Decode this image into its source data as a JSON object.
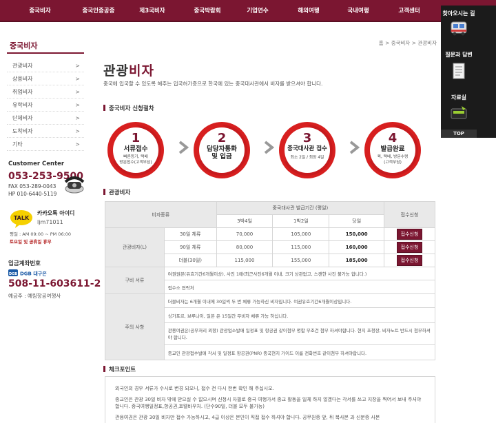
{
  "nav": {
    "items": [
      "중국비자",
      "중국인증공증",
      "제3국비자",
      "중국박람회",
      "기업연수",
      "해외여행",
      "국내여행",
      "고객센터"
    ]
  },
  "quick_panel": {
    "directions_label": "찾아오시는 길",
    "qna_label": "질문과 답변",
    "library_label": "자료실",
    "top_label": "TOP"
  },
  "sidebar": {
    "title": "중국비자",
    "items": [
      {
        "label": "관광비자",
        "arrow": ">"
      },
      {
        "label": "상용비자",
        "arrow": ">"
      },
      {
        "label": "취업비자",
        "arrow": ">"
      },
      {
        "label": "유학비자",
        "arrow": ">"
      },
      {
        "label": "단체비자",
        "arrow": ">"
      },
      {
        "label": "도착비자",
        "arrow": ">"
      },
      {
        "label": "기타",
        "arrow": ">"
      }
    ]
  },
  "customer_center": {
    "title": "Customer Center",
    "phone": "053-253-9500",
    "fax": "FAX  053-289-0043",
    "hp": "HP   010-6440-5119"
  },
  "kakao": {
    "badge": "TALK",
    "title": "카카오톡 아이디",
    "id": "ljm71011",
    "hours": "평일 : AM 09:00 ~ PM 06:00",
    "holiday": "토요일 및 공휴일 휴무"
  },
  "account": {
    "title": "입금계좌번호",
    "bank": "DGB 대구은행",
    "number": "508-11-603611-2",
    "holder": "예금주 : 예림항공여행사"
  },
  "breadcrumb": "홈 > 중국비자 > 관광비자",
  "page": {
    "title_main": "관광",
    "title_accent": "비자",
    "description": "중국에 입국할 수 있도록 해주는 입국허가증으로 한국에 있는 중국대사관에서 비자를 받으셔야 합니다."
  },
  "process": {
    "heading": "중국비자 신청절차",
    "steps": [
      {
        "num": "1",
        "title": "서류접수",
        "sub": [
          "빠른등기, 택배",
          "방문접수(고객부담)"
        ]
      },
      {
        "num": "2",
        "title": "담당자통화\n및 입금",
        "sub": []
      },
      {
        "num": "3",
        "title": "중국대사관 접수",
        "sub": [
          "최소 2일 / 최장 4일"
        ]
      },
      {
        "num": "4",
        "title": "발급완료",
        "sub": [
          "퀵, 택배, 방문수령",
          "(고객부담)"
        ]
      }
    ]
  },
  "visa_table": {
    "heading": "관광비자",
    "col_type": "비자종류",
    "col_period": "중국대사관 발급기간 (평일)",
    "col_apply": "접수신청",
    "sub_cols": [
      "3박4일",
      "1박2일",
      "당일"
    ],
    "row_label": "관광비자(L)",
    "rows": [
      {
        "stay": "30일 체류",
        "prices": [
          "70,000",
          "105,000",
          "150,000"
        ],
        "button": "접수신청"
      },
      {
        "stay": "90일 체류",
        "prices": [
          "80,000",
          "115,000",
          "160,000"
        ],
        "button": "접수신청"
      },
      {
        "stay": "더블(30일)",
        "prices": [
          "115,000",
          "155,000",
          "185,000"
        ],
        "button": "접수신청"
      }
    ],
    "docs_label": "구비 서류",
    "docs": [
      "여권원본(유효기간6개월이상), 사진 1매(최근사진6개월 이내, 크기 상관없고, 스캔한 사진 불가능 합니다.)",
      "접수소 연락처"
    ],
    "notes_label": "주의 사항",
    "notes": [
      "더블비자는 6개월 이내에 30일씩 두 번 체류 가능하신 비자입니다. 여권유효기간6개월이상입니다.",
      "싱가포르, 브루나이, 일본 은 15일간 무비자 체류 가능 하십니다.",
      "관용여권은(공무처리 외항) 관광업소발매 일정표 및 항공권 같이첨부 명함 무조건 첨부 하셔야합니다.  현지 초청장, 비자노트 반드시 첨부하셔야 합니다.",
      "종교인 관광접수발매 각서 및 일정표 항공권(PNR) 중국현지 가이드 이름 전화번호 같이첨부 하셔야합니다."
    ]
  },
  "checkpoint": {
    "heading": "체크포인트",
    "paragraphs": [
      "외국인의 경우 서류가 수시로 변경 되오니, 접수 전 다시 한번 확인 해 주십시오.",
      "종교인은 관광 30일 비자 밖에 받으실 수 없으시며 신청시 자필로 중국 여행가서 종교 활동을 일체 하지 않겠다는 각서를 쓰고 지장을 찍어서 보내 주셔야 합니다. 중국여행일정표,항공권,호텔바우처. (단수90일, 더블 모두 불가능)",
      "관용여권은 관광 30일 비자만 접수 가능하시고, 4급 이상은 본인이 직접 접수 하셔야 합니다. 공무원증 앞, 뒤 복사본 과 신분증 사본"
    ]
  },
  "colors": {
    "brand": "#7b1631",
    "nav_bg": "#7b1631",
    "panel_bg": "#1b1b1b",
    "step_red": "#d71f1f"
  }
}
